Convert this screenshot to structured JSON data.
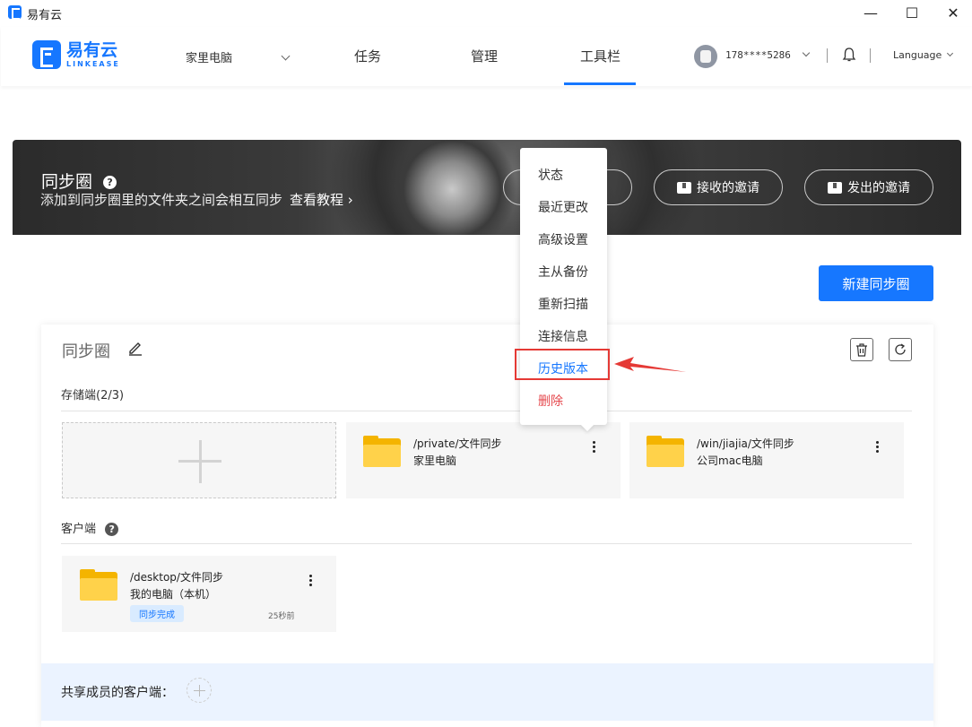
{
  "window": {
    "title": "易有云",
    "minimize": "—",
    "maximize": "☐",
    "close": "✕"
  },
  "nav": {
    "logo_cn": "易有云",
    "logo_en": "LINKEASE",
    "device": "家里电脑",
    "tabs": [
      "任务",
      "管理",
      "工具栏"
    ],
    "active_tab": "工具栏",
    "user_phone": "178****5286",
    "language": "Language"
  },
  "banner": {
    "title": "同步圈",
    "subtitle": "添加到同步圈里的文件夹之间会相互同步",
    "tutorial_link": "查看教程 ›",
    "received_invites": "接收的邀请",
    "sent_invites": "发出的邀请"
  },
  "new_circle_button": "新建同步圈",
  "circle": {
    "title": "同步圈",
    "storage_label": "存储端(2/3)",
    "storage": [
      {
        "path": "/private/文件同步",
        "device": "家里电脑"
      },
      {
        "path": "/win/jiajia/文件同步",
        "device": "公司mac电脑"
      }
    ],
    "client_label": "客户端",
    "clients": [
      {
        "path": "/desktop/文件同步",
        "device": "我的电脑（本机）",
        "status": "同步完成",
        "time": "25秒前"
      }
    ],
    "shared_label": "共享成员的客户端："
  },
  "menu": {
    "items": [
      "状态",
      "最近更改",
      "高级设置",
      "主从备份",
      "重新扫描",
      "连接信息",
      "历史版本",
      "删除"
    ],
    "highlighted": "历史版本"
  },
  "colors": {
    "accent": "#1677ff",
    "danger": "#e5484d",
    "annotation": "#e53935"
  }
}
